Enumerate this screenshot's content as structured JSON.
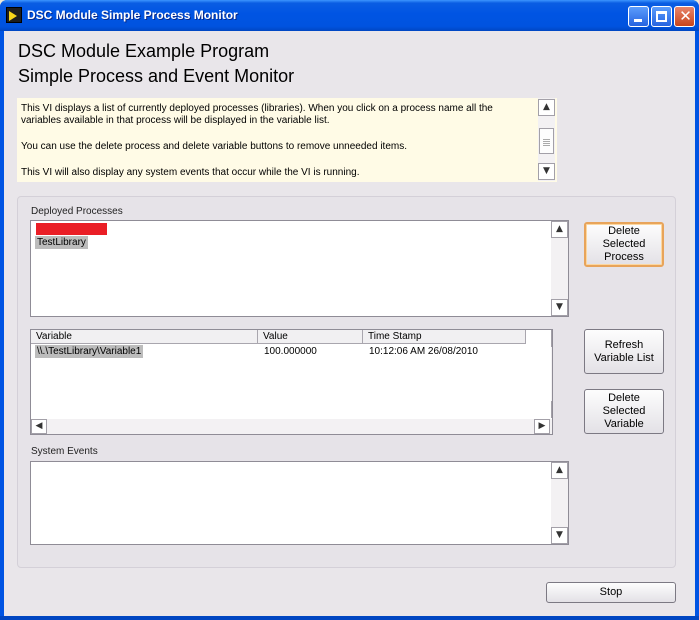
{
  "window": {
    "title": "DSC Module Simple Process Monitor"
  },
  "heading": {
    "line1": "DSC Module Example Program",
    "line2": "Simple Process and Event Monitor"
  },
  "info": {
    "paragraphs": [
      "This VI displays a list of currently deployed processes (libraries).  When you click on a process name all the variables available in that process will be displayed in the variable list.",
      "You can use the delete process and delete variable buttons to remove unneeded items.",
      "This VI will also display any system events that occur while the VI is running."
    ]
  },
  "deployed_processes": {
    "label": "Deployed Processes",
    "items": [
      "TestLibrary"
    ],
    "highlight_color": "#ea1e26"
  },
  "variables": {
    "columns": [
      "Variable",
      "Value",
      "Time Stamp"
    ],
    "rows": [
      [
        "\\\\.\\TestLibrary\\Variable1",
        "100.000000",
        "10:12:06 AM 26/08/2010"
      ]
    ]
  },
  "system_events": {
    "label": "System Events"
  },
  "buttons": {
    "delete_process": "Delete Selected Process",
    "refresh": "Refresh Variable List",
    "delete_variable": "Delete Selected Variable",
    "stop": "Stop"
  },
  "icons": {
    "scroll_up": "▲",
    "scroll_down": "▼",
    "scroll_left": "◀",
    "scroll_right": "▶",
    "close": "✕"
  }
}
